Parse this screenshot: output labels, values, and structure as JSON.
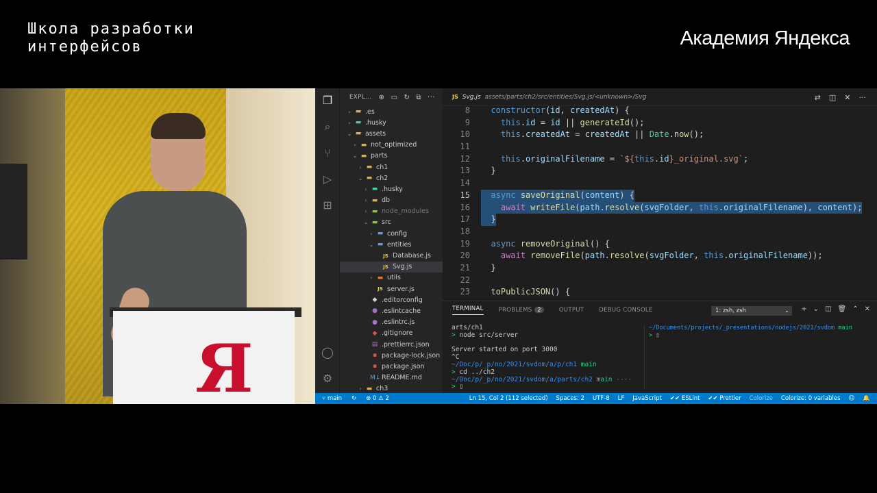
{
  "header": {
    "school_line1": "Школа разработки",
    "school_line2": "интерфейсов",
    "academy": "Академия Яндекса"
  },
  "podium_logo": "Я",
  "explorer": {
    "title": "EXPL...",
    "items": [
      {
        "label": ".es",
        "icon": "folder-icon",
        "indent": 1,
        "chev": "›"
      },
      {
        "label": ".husky",
        "icon": "husky-folder-icon",
        "indent": 1,
        "chev": "›"
      },
      {
        "label": "assets",
        "icon": "folder-open-icon",
        "indent": 1,
        "chev": "⌄"
      },
      {
        "label": "not_optimized",
        "icon": "folder-icon",
        "indent": 2,
        "chev": "›"
      },
      {
        "label": "parts",
        "icon": "folder-open-icon",
        "indent": 2,
        "chev": "⌄"
      },
      {
        "label": "ch1",
        "icon": "folder-icon",
        "indent": 3,
        "chev": "›"
      },
      {
        "label": "ch2",
        "icon": "folder-open-icon",
        "indent": 3,
        "chev": "⌄"
      },
      {
        "label": ".husky",
        "icon": "husky-folder-icon",
        "indent": 4,
        "chev": "›"
      },
      {
        "label": "db",
        "icon": "folder-icon",
        "indent": 4,
        "chev": "›"
      },
      {
        "label": "node_modules",
        "icon": "node-folder-icon",
        "indent": 4,
        "chev": "›",
        "dim": true
      },
      {
        "label": "src",
        "icon": "src-folder-icon",
        "indent": 4,
        "chev": "⌄"
      },
      {
        "label": "config",
        "icon": "config-folder-icon",
        "indent": 5,
        "chev": "›"
      },
      {
        "label": "entities",
        "icon": "entities-folder-icon",
        "indent": 5,
        "chev": "⌄"
      },
      {
        "label": "Database.js",
        "icon": "js-file-icon",
        "indent": 6,
        "chev": ""
      },
      {
        "label": "Svg.js",
        "icon": "js-file-icon",
        "indent": 6,
        "chev": "",
        "selected": true
      },
      {
        "label": "utils",
        "icon": "utils-folder-icon",
        "indent": 5,
        "chev": "›"
      },
      {
        "label": "server.js",
        "icon": "js-file-icon",
        "indent": 5,
        "chev": ""
      },
      {
        "label": ".editorconfig",
        "icon": "editorconfig-icon",
        "indent": 4,
        "chev": ""
      },
      {
        "label": ".eslintcache",
        "icon": "eslint-icon",
        "indent": 4,
        "chev": ""
      },
      {
        "label": ".eslintrc.js",
        "icon": "eslint-icon",
        "indent": 4,
        "chev": ""
      },
      {
        "label": ".gitignore",
        "icon": "git-icon",
        "indent": 4,
        "chev": ""
      },
      {
        "label": ".prettierrc.json",
        "icon": "prettier-icon",
        "indent": 4,
        "chev": ""
      },
      {
        "label": "package-lock.json",
        "icon": "npm-icon",
        "indent": 4,
        "chev": ""
      },
      {
        "label": "package.json",
        "icon": "npm-icon",
        "indent": 4,
        "chev": ""
      },
      {
        "label": "README.md",
        "icon": "markdown-icon",
        "indent": 4,
        "chev": ""
      },
      {
        "label": "ch3",
        "icon": "folder-icon",
        "indent": 3,
        "chev": "›"
      }
    ]
  },
  "tab": {
    "badge": "JS",
    "filename": "Svg.js",
    "breadcrumb": "assets/parts/ch2/src/entities/Svg.js/<unknown>/Svg"
  },
  "code": {
    "lines": [
      {
        "n": "8",
        "html": "  <span class='k'>constructor</span>(<span class='v'>id</span>, <span class='v'>createdAt</span>) {"
      },
      {
        "n": "9",
        "html": "    <span class='k'>this</span>.<span class='v'>id</span> = <span class='v'>id</span> || <span class='f'>generateId</span>();"
      },
      {
        "n": "10",
        "html": "    <span class='k'>this</span>.<span class='v'>createdAt</span> = <span class='v'>createdAt</span> || <span class='t'>Date</span>.<span class='f'>now</span>();"
      },
      {
        "n": "11",
        "html": ""
      },
      {
        "n": "12",
        "html": "    <span class='k'>this</span>.<span class='v'>originalFilename</span> = <span class='s'>`${</span><span class='k'>this</span>.<span class='v'>id</span><span class='s'>}_original.svg`</span>;"
      },
      {
        "n": "13",
        "html": "  }"
      },
      {
        "n": "14",
        "html": ""
      },
      {
        "n": "15",
        "html": "  <span class='k'>async</span> <span class='f'>saveOriginal</span>(<span class='v'>content</span>) {",
        "sel": true,
        "cur": true
      },
      {
        "n": "16",
        "html": "    <span class='kc'>await</span> <span class='f'>writeFile</span>(<span class='v'>path</span>.<span class='f'>resolve</span>(<span class='v'>svgFolder</span>, <span class='k'>this</span>.<span class='v'>originalFilename</span>), <span class='v'>content</span>);",
        "sel": true
      },
      {
        "n": "17",
        "html": "  }",
        "sel": true
      },
      {
        "n": "18",
        "html": ""
      },
      {
        "n": "19",
        "html": "  <span class='k'>async</span> <span class='f'>removeOriginal</span>() {"
      },
      {
        "n": "20",
        "html": "    <span class='kc'>await</span> <span class='f'>removeFile</span>(<span class='v'>path</span>.<span class='f'>resolve</span>(<span class='v'>svgFolder</span>, <span class='k'>this</span>.<span class='v'>originalFilename</span>));"
      },
      {
        "n": "21",
        "html": "  }"
      },
      {
        "n": "22",
        "html": ""
      },
      {
        "n": "23",
        "html": "  <span class='f'>toPublicJSON</span>() {"
      }
    ]
  },
  "panel": {
    "tabs": {
      "terminal": "TERMINAL",
      "problems": "PROBLEMS",
      "problems_count": "2",
      "output": "OUTPUT",
      "debug": "DEBUG CONSOLE"
    },
    "terminal_select": "1: zsh, zsh",
    "terminal_lines": [
      "arts/ch1",
      "> node src/server",
      "",
      "Server started on port 3000",
      "^C",
      "~/Doc/p/_p/no/2021/svdom/a/p/ch1 main",
      "> cd ../ch2",
      "~/Doc/p/_p/no/2021/svdom/a/parts/ch2 main ····",
      "> ▯"
    ],
    "terminal2_lines": [
      "~/Documents/projects/_presentations/nodejs/2021/svdom main",
      "> ▯"
    ]
  },
  "status": {
    "branch": "main",
    "errors": "⊗ 0 ⚠ 2",
    "position": "Ln 15, Col 2 (112 selected)",
    "spaces": "Spaces: 2",
    "encoding": "UTF-8",
    "eol": "LF",
    "language": "JavaScript",
    "eslint": "ESLint",
    "prettier": "Prettier",
    "colorize": "Colorize",
    "colorize_vars": "Colorize: 0 variables"
  }
}
